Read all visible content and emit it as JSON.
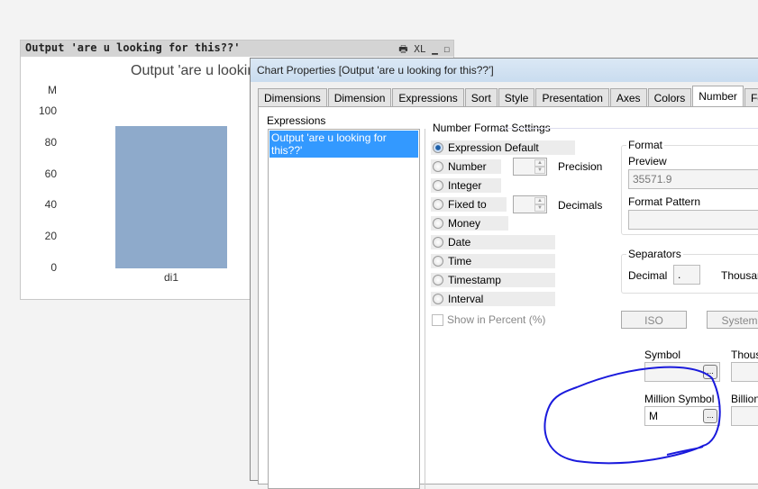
{
  "chart_object": {
    "caption": "Output 'are u looking for this??'",
    "caption_icons": "🖶 XL ▁ ☐"
  },
  "chart_data": {
    "type": "bar",
    "title": "Output 'are u looking for this??'",
    "ylabel": "M",
    "categories": [
      "di1"
    ],
    "values": [
      91
    ],
    "ylim": [
      0,
      100
    ],
    "yticks": [
      "0",
      "20",
      "40",
      "60",
      "80",
      "100"
    ],
    "bar_color": "#8eaacb"
  },
  "dialog": {
    "title": "Chart Properties [Output 'are u looking for this??']",
    "tabs": [
      "Dimensions",
      "Dimension Limits",
      "Expressions",
      "Sort",
      "Style",
      "Presentation",
      "Axes",
      "Colors",
      "Number",
      "Font"
    ],
    "active_tab": "Number",
    "expressions_label": "Expressions",
    "expressions": [
      "Output 'are u looking for this??'"
    ],
    "nfs_label": "Number Format Settings",
    "formats": [
      "Expression Default",
      "Number",
      "Integer",
      "Fixed to",
      "Money",
      "Date",
      "Time",
      "Timestamp",
      "Interval"
    ],
    "selected_format": "Expression Default",
    "precision_label": "Precision",
    "decimals_label": "Decimals",
    "show_percent": "Show in Percent (%)",
    "format_group": "Format",
    "preview_label": "Preview",
    "preview_value": "35571.9",
    "pattern_label": "Format Pattern",
    "separators_group": "Separators",
    "decimal_label": "Decimal",
    "decimal_value": ".",
    "thousand_label": "Thousan",
    "iso_button": "ISO",
    "system_button": "System",
    "symbol_label": "Symbol",
    "thousand_symbol_label": "Thous",
    "million_label": "Million Symbol",
    "million_value": "M",
    "billion_label": "Billion S",
    "dots": "..."
  },
  "annotation_color": "#1a1adc"
}
